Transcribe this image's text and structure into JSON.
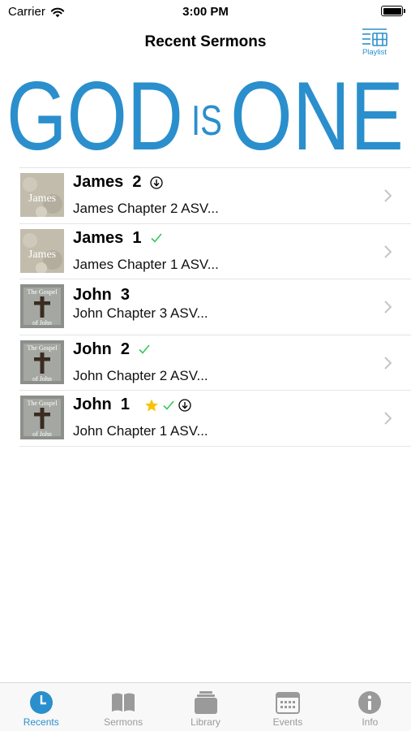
{
  "status_bar": {
    "carrier": "Carrier",
    "time": "3:00 PM"
  },
  "nav": {
    "title": "Recent Sermons",
    "playlist_label": "Playlist"
  },
  "banner": {
    "text_left": "GOD",
    "text_mid": "IS",
    "text_right": "ONE",
    "color": "#2a8fcc"
  },
  "colors": {
    "accent": "#2a8fcc",
    "check": "#34c759",
    "star": "#f5c400",
    "chevron": "#c4c4c9"
  },
  "sermons": [
    {
      "title": "James  2",
      "subtitle": "James Chapter 2 ASV...",
      "thumb": "James",
      "downloadable": true,
      "played": false,
      "starred": false
    },
    {
      "title": "James  1",
      "subtitle": "James Chapter 1 ASV...",
      "thumb": "James",
      "downloadable": false,
      "played": true,
      "starred": false
    },
    {
      "title": "John  3",
      "subtitle": "John Chapter 3 ASV...",
      "thumb_line1": "The Gospel",
      "thumb_line2": "of John",
      "downloadable": false,
      "played": false,
      "starred": false
    },
    {
      "title": "John  2",
      "subtitle": "John Chapter 2 ASV...",
      "thumb_line1": "The Gospel",
      "thumb_line2": "of John",
      "downloadable": false,
      "played": true,
      "starred": false
    },
    {
      "title": "John  1",
      "subtitle": "John Chapter 1 ASV...",
      "thumb_line1": "The Gospel",
      "thumb_line2": "of John",
      "downloadable": true,
      "played": true,
      "starred": true
    }
  ],
  "tabs": [
    {
      "label": "Recents",
      "icon": "clock-icon",
      "active": true
    },
    {
      "label": "Sermons",
      "icon": "book-icon",
      "active": false
    },
    {
      "label": "Library",
      "icon": "library-stack-icon",
      "active": false
    },
    {
      "label": "Events",
      "icon": "calendar-icon",
      "active": false
    },
    {
      "label": "Info",
      "icon": "info-icon",
      "active": false
    }
  ]
}
